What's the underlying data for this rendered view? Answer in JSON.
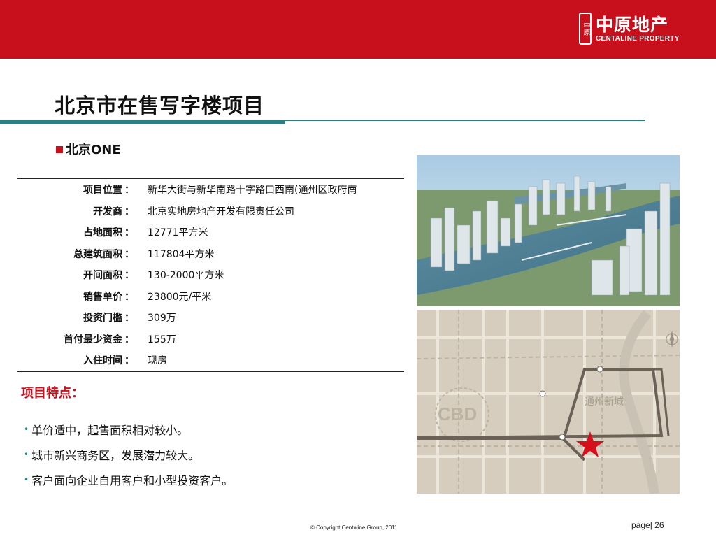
{
  "header": {
    "logo_seal": "中原",
    "logo_cn": "中原地产",
    "logo_en": "CENTALINE PROPERTY",
    "brand_color": "#c8101c",
    "accent_color": "#2a7f86"
  },
  "page_title": "北京市在售写字楼项目",
  "project": {
    "name": "北京ONE",
    "rows": [
      {
        "key": "项目位置",
        "value": "新华大街与新华南路十字路口西南(通州区政府南"
      },
      {
        "key": "开发商",
        "value": " 北京实地房地产开发有限责任公司"
      },
      {
        "key": "占地面积",
        "value": "12771平方米"
      },
      {
        "key": "总建筑面积",
        "value": "117804平方米"
      },
      {
        "key": "开间面积",
        "value": "130-2000平方米"
      },
      {
        "key": "销售单价",
        "value": "23800元/平米"
      },
      {
        "key": "投资门槛",
        "value": "309万"
      },
      {
        "key": "首付最少资金",
        "value": "155万"
      },
      {
        "key": "入住时间",
        "value": "现房"
      }
    ],
    "separator": "："
  },
  "features": {
    "title": "项目特点：",
    "items": [
      "单价适中，起售面积相对较小。",
      "城市新兴商务区，发展潜力较大。",
      "客户面向企业自用客户和小型投资客户。"
    ]
  },
  "map": {
    "label_cbd": "CBD",
    "label_district": "通州新城"
  },
  "footer": {
    "copyright": "© Copyright  Centaline Group, 2011",
    "page_label": "page|   26"
  }
}
